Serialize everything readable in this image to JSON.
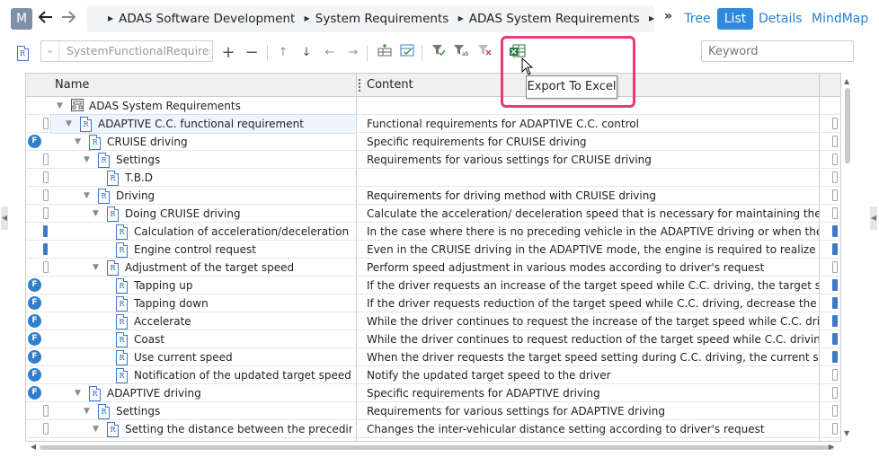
{
  "user": {
    "initial": "M"
  },
  "breadcrumb": [
    "ADAS Software Development",
    "System Requirements",
    "ADAS System Requirements"
  ],
  "more": "»",
  "views": {
    "tree": "Tree",
    "list": "List",
    "details": "Details",
    "mindmap": "MindMap"
  },
  "toolbar": {
    "path_field": "SystemFunctionalRequirements",
    "keyword_placeholder": "Keyword"
  },
  "tooltip": "Export To Excel",
  "grid": {
    "headers": {
      "name": "Name",
      "content": "Content"
    },
    "rows": [
      {
        "level": 0,
        "expander": "open",
        "icon": "folder",
        "name": "ADAS System Requirements",
        "content": "",
        "left_mark": "none",
        "right_mark": "none"
      },
      {
        "level": 1,
        "expander": "open",
        "icon": "req",
        "name": "ADAPTIVE C.C. functional requirement",
        "content": "Functional requirements for ADAPTIVE C.C. control",
        "left_mark": "box",
        "right_mark": "box",
        "selected": true
      },
      {
        "level": 2,
        "expander": "open",
        "icon": "req",
        "name": "CRUISE driving",
        "content": "Specific requirements for CRUISE driving",
        "left_mark": "f",
        "right_mark": "box"
      },
      {
        "level": 3,
        "expander": "open",
        "icon": "req",
        "name": "Settings",
        "content": "Requirements for various settings for CRUISE driving",
        "left_mark": "box",
        "right_mark": "box"
      },
      {
        "level": 4,
        "expander": "none",
        "icon": "req",
        "name": "T.B.D",
        "content": "",
        "left_mark": "box",
        "right_mark": "box"
      },
      {
        "level": 3,
        "expander": "open",
        "icon": "req",
        "name": "Driving",
        "content": "Requirements for driving method with CRUISE driving",
        "left_mark": "box",
        "right_mark": "box"
      },
      {
        "level": 4,
        "expander": "open",
        "icon": "req",
        "name": "Doing CRUISE driving",
        "content": "Calculate the acceleration/ deceleration speed that is necessary for maintaining the target speed",
        "left_mark": "box",
        "right_mark": "box"
      },
      {
        "level": 5,
        "expander": "none",
        "icon": "req",
        "name": "Calculation of acceleration/deceleration spee···",
        "content": "In the case where there is no preceding vehicle in the ADAPTIVE driving or when the vehicle is d",
        "left_mark": "bar",
        "right_mark": "bar"
      },
      {
        "level": 5,
        "expander": "none",
        "icon": "req",
        "name": "Engine control request",
        "content": "Even in the CRUISE driving in the ADAPTIVE mode, the engine is required to realize the calculate",
        "left_mark": "bar",
        "right_mark": "bar"
      },
      {
        "level": 4,
        "expander": "open",
        "icon": "req",
        "name": "Adjustment of the target speed",
        "content": "Perform speed adjustment in various modes according to driver's request",
        "left_mark": "box",
        "right_mark": "box"
      },
      {
        "level": 5,
        "expander": "none",
        "icon": "req",
        "name": "Tapping up",
        "content": "If the driver requests an increase of the target speed while C.C. driving, the target speed is incre",
        "left_mark": "f",
        "right_mark": "bar"
      },
      {
        "level": 5,
        "expander": "none",
        "icon": "req",
        "name": "Tapping down",
        "content": "If the driver requests reduction of the target speed while C.C. driving, decrease the target speed",
        "left_mark": "f",
        "right_mark": "bar"
      },
      {
        "level": 5,
        "expander": "none",
        "icon": "req",
        "name": "Accelerate",
        "content": "While the driver continues to request the increase of the target speed while C.C. driving with CR",
        "left_mark": "f",
        "right_mark": "bar"
      },
      {
        "level": 5,
        "expander": "none",
        "icon": "req",
        "name": "Coast",
        "content": "While the driver continues to request reduction of the target speed while C.C. driving, gradually d",
        "left_mark": "f",
        "right_mark": "bar"
      },
      {
        "level": 5,
        "expander": "none",
        "icon": "req",
        "name": "Use current speed",
        "content": "When the driver requests the target speed setting during C.C. driving, the current speed is set to",
        "left_mark": "f",
        "right_mark": "bar"
      },
      {
        "level": 5,
        "expander": "none",
        "icon": "req",
        "name": "Notification of the updated target speed",
        "content": "Notify the updated target speed to the driver",
        "left_mark": "f",
        "right_mark": "box"
      },
      {
        "level": 2,
        "expander": "open",
        "icon": "req",
        "name": "ADAPTIVE driving",
        "content": "Specific requirements for ADAPTIVE driving",
        "left_mark": "f",
        "right_mark": "box"
      },
      {
        "level": 3,
        "expander": "open",
        "icon": "req",
        "name": "Settings",
        "content": "Requirements for various settings for ADAPTIVE driving",
        "left_mark": "box",
        "right_mark": "box"
      },
      {
        "level": 4,
        "expander": "open",
        "icon": "req",
        "name": "Setting the distance between the preceding ve···",
        "content": "Changes the inter-vehicular distance setting according to driver's request",
        "left_mark": "box",
        "right_mark": "box"
      }
    ]
  },
  "colors": {
    "accent": "#2f89dc",
    "highlight": "#ee3a6a",
    "mark": "#2f7fcf"
  }
}
